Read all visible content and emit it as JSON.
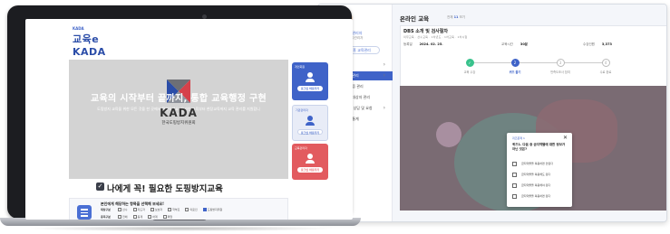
{
  "back_screen": {
    "user": {
      "name": "관리자",
      "role": "시도관리자",
      "sub": "사용자관리자"
    },
    "home_button": "홈 교육관리",
    "menu": [
      {
        "label": "운영",
        "chevron": true
      },
      {
        "label": "교육관리",
        "chevron": true,
        "active": true
      },
      {
        "label": "수료증 관리",
        "chevron": false
      },
      {
        "label": "교육대상자 관리",
        "chevron": false
      },
      {
        "label": "교육 상담 및 요청",
        "chevron": true
      },
      {
        "label": "운영통계",
        "chevron": false
      }
    ],
    "page_title": "온라인 교육",
    "page_sub_prefix": "전체",
    "page_sub_count": "11",
    "page_sub_suffix": "보기",
    "course_title": "DBS 소개 및 검사절차",
    "tags": "의무교육 · 선수교육 · 1차년도 · 1차교육 · 1차시험",
    "info": [
      {
        "label": "등록일",
        "value": "2024. 02. 25."
      },
      {
        "label": "교육시간",
        "value": "30분"
      },
      {
        "label": "수강인원",
        "value": "3,373"
      }
    ],
    "steps": [
      {
        "label": "교육 수강",
        "state": "done",
        "num": "✓"
      },
      {
        "label": "퀴즈 풀기",
        "state": "current",
        "num": "2"
      },
      {
        "label": "만족도조사 참여",
        "state": "todo",
        "num": "3"
      },
      {
        "label": "수료 완료",
        "state": "todo",
        "num": "4"
      }
    ],
    "modal": {
      "label": "퀴즈문제 1",
      "close": "✕",
      "question": "퀴즈1. 다음 중 금지약물에 대한 정보가 아닌 것은?",
      "options": [
        "금지약물을 복용하면 안된다",
        "금지약물을 복용해도 된다",
        "금지약물을 복용해야 된다",
        "금지약물을 복용하면 된다"
      ]
    }
  },
  "laptop": {
    "logo_small": "KADA",
    "logo_main": "교육e KADA",
    "hero_title": "교육의 시작부터 끝까지, 통합 교육행정 구현",
    "hero_sub": "도핑방지 교육을 위한 모든 것을 한 곳에서 확인하세요. 온라인 교육부터 현장교육까지 교육 관리를 지원합니다.",
    "kada_text": "KADA",
    "kada_sub": "한국도핑방지위원회",
    "cards": [
      {
        "top": "개인회원",
        "button": "로그인 바로가기"
      },
      {
        "top": "기관관리자",
        "button": "로그인 바로가기"
      },
      {
        "top": "교육관리자",
        "button": "로그인 바로가기"
      }
    ],
    "section_title": "나에게 꼭! 필요한 도핑방지교육",
    "filter": {
      "head": "본인에게 해당하는 항목을 선택해 보세요!",
      "rows": [
        {
          "label": "대상구분",
          "opts": [
            "선수",
            "지도자",
            "보호자",
            "학부모",
            "의료인",
            "도핑방지위원"
          ],
          "checked": 5
        },
        {
          "label": "종목구분",
          "opts": [
            "전체",
            "동계",
            "하계",
            "패럴"
          ],
          "checked": -1
        }
      ]
    }
  }
}
